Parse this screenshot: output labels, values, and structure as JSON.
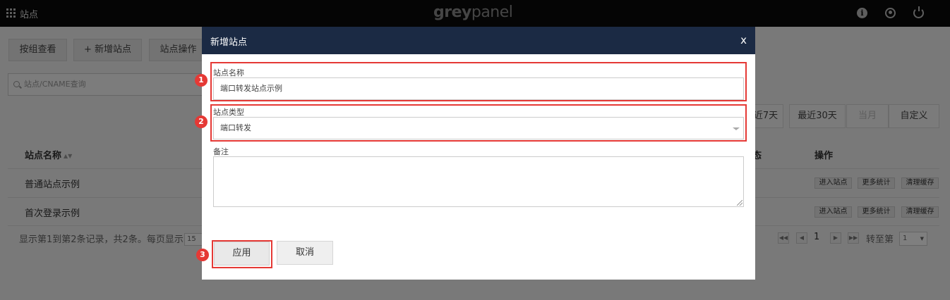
{
  "topbar": {
    "app_title": "站点",
    "logo_bold": "grey",
    "logo_light": "panel",
    "icons": [
      "grid-icon",
      "info-icon",
      "user-icon",
      "power-icon"
    ]
  },
  "toolbar": {
    "group_view": "按组查看",
    "add_site": "+ 新增站点",
    "site_ops": "站点操作"
  },
  "search": {
    "placeholder": "站点/CNAME查询"
  },
  "date_range": {
    "last7": "近7天",
    "last30": "最近30天",
    "this_month": "当月",
    "custom": "自定义"
  },
  "table": {
    "headers": {
      "name": "站点名称",
      "status": "态",
      "actions": "操作"
    },
    "rows": [
      {
        "name": "普通站点示例",
        "actions": [
          "进入站点",
          "更多统计",
          "清理缓存"
        ]
      },
      {
        "name": "首次登录示例",
        "actions": [
          "进入站点",
          "更多统计",
          "清理缓存"
        ]
      }
    ]
  },
  "footer": {
    "summary": "显示第1到第2条记录，共2条。每页显示",
    "page_size": "15",
    "current_page": "1",
    "goto_label": "转至第",
    "goto_value": "1"
  },
  "modal": {
    "title": "新增站点",
    "close": "x",
    "fields": {
      "site_name_label": "站点名称",
      "site_name_value": "端口转发站点示例",
      "site_type_label": "站点类型",
      "site_type_value": "端口转发",
      "note_label": "备注"
    },
    "apply": "应用",
    "cancel": "取消",
    "steps": [
      "1",
      "2",
      "3"
    ],
    "highlight_color": "#e53935"
  }
}
